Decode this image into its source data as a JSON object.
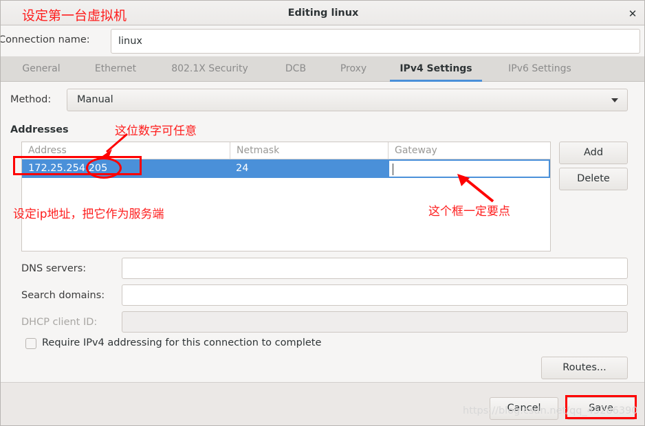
{
  "window": {
    "title": "Editing linux",
    "close_icon": "close-icon"
  },
  "connection": {
    "label": "Connection name:",
    "value": "linux",
    "placeholder": ""
  },
  "tabs": [
    {
      "label": "General",
      "active": false
    },
    {
      "label": "Ethernet",
      "active": false
    },
    {
      "label": "802.1X Security",
      "active": false
    },
    {
      "label": "DCB",
      "active": false
    },
    {
      "label": "Proxy",
      "active": false
    },
    {
      "label": "IPv4 Settings",
      "active": true
    },
    {
      "label": "IPv6 Settings",
      "active": false
    }
  ],
  "method": {
    "label": "Method:",
    "value": "Manual",
    "arrow_icon": "chevron-down-icon"
  },
  "addresses": {
    "section_label": "Addresses",
    "columns": [
      "Address",
      "Netmask",
      "Gateway"
    ],
    "rows": [
      {
        "address": "172.25.254.205",
        "netmask": "24",
        "gateway": ""
      }
    ],
    "add_label": "Add",
    "delete_label": "Delete"
  },
  "fields": {
    "dns_label": "DNS servers:",
    "dns_value": "",
    "search_label": "Search domains:",
    "search_value": "",
    "dhcp_label": "DHCP client ID:",
    "dhcp_value": ""
  },
  "require_ipv4": {
    "label": "Require IPv4 addressing for this connection to complete",
    "checked": false
  },
  "routes": {
    "label": "Routes..."
  },
  "actions": {
    "cancel_label": "Cancel",
    "save_label": "Save"
  },
  "annotations": {
    "title_note": "设定第一台虚拟机",
    "digit_note": "这位数字可任意",
    "ip_note": "设定ip地址，把它作为服务端",
    "gateway_note": "这个框一定要点"
  },
  "watermark": "https://blog.csdn.net/qq_45286390",
  "colors": {
    "accent": "#4a90d9",
    "annotation_red": "#fe0000",
    "panel": "#f6f5f4",
    "tabbar": "#dcdad7"
  }
}
